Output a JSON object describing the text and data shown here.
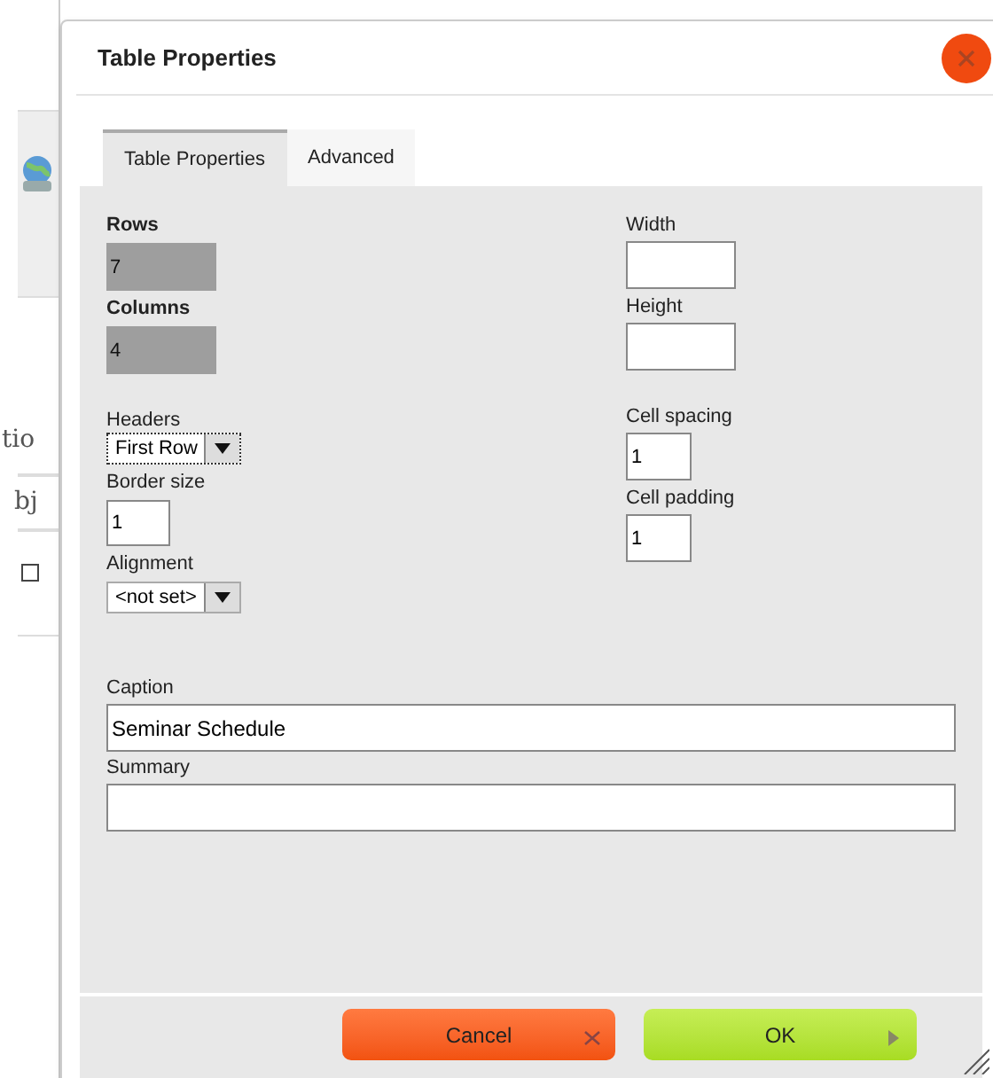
{
  "background": {
    "fragments": [
      "tio",
      "bj"
    ],
    "checkbox": {
      "checked": false
    }
  },
  "dialog": {
    "title": "Table Properties",
    "tabs": [
      {
        "label": "Table Properties",
        "selected": true
      },
      {
        "label": "Advanced",
        "selected": false
      }
    ],
    "left_fields": [
      {
        "kind": "input",
        "label": "Rows",
        "value": "7",
        "disabled": true
      },
      {
        "kind": "input",
        "label": "Columns",
        "value": "4",
        "disabled": true
      },
      {
        "kind": "select",
        "label": "Headers",
        "value": "First Row",
        "focused": true
      },
      {
        "kind": "input",
        "label": "Border size",
        "value": "1",
        "disabled": false
      },
      {
        "kind": "select",
        "label": "Alignment",
        "value": "<not set>",
        "focused": false
      }
    ],
    "right_fields": [
      {
        "label": "Width"
      },
      {
        "label": "Height"
      },
      {
        "label": "Cell spacing",
        "value": "1"
      },
      {
        "label": "Cell padding",
        "value": "1"
      }
    ],
    "caption": {
      "label": "Caption",
      "value": "Seminar Schedule"
    },
    "summary": {
      "label": "Summary"
    },
    "buttons": [
      {
        "kind": "cancel",
        "label": "Cancel"
      },
      {
        "kind": "ok",
        "label": "OK"
      }
    ]
  }
}
